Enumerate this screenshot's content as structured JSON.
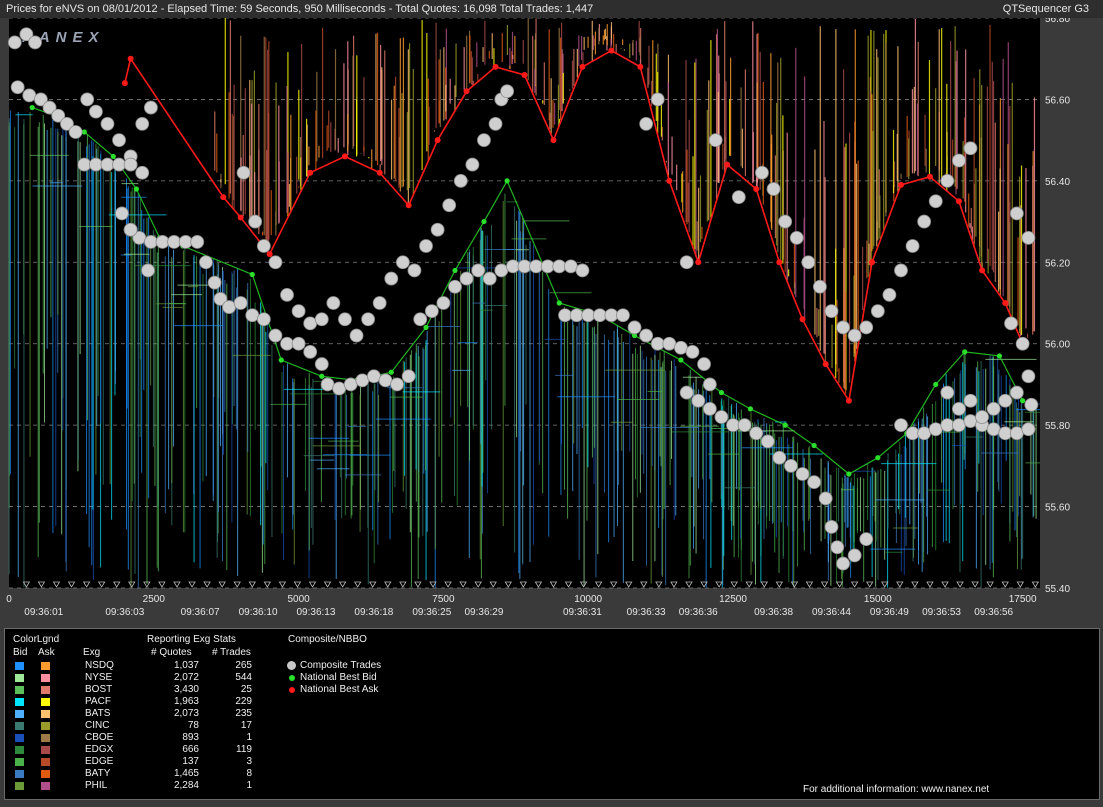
{
  "header": {
    "left": "Prices for  eNVS  on  08/01/2012  -  Elapsed Time: 59 Seconds, 950 Milliseconds  -  Total Quotes: 16,098  Total Trades: 1,447",
    "right": "QTSequencer G3"
  },
  "watermark": "NANEX",
  "chart_data": {
    "type": "scatter",
    "xlim": [
      0,
      17800
    ],
    "ylim": [
      55.4,
      56.8
    ],
    "x_ticks": [
      0,
      2500,
      5000,
      7500,
      10000,
      12500,
      15000,
      17500
    ],
    "y_ticks": [
      "56.80",
      "56.60",
      "56.40",
      "56.20",
      "56.00",
      "55.80",
      "55.60",
      "55.40"
    ],
    "time_ticks": [
      {
        "x": 600,
        "label": "09:36:01"
      },
      {
        "x": 2000,
        "label": "09:36:03"
      },
      {
        "x": 3300,
        "label": "09:36:07"
      },
      {
        "x": 4300,
        "label": "09:36:10"
      },
      {
        "x": 5300,
        "label": "09:36:13"
      },
      {
        "x": 6300,
        "label": "09:36:18"
      },
      {
        "x": 7300,
        "label": "09:36:25"
      },
      {
        "x": 8200,
        "label": "09:36:29"
      },
      {
        "x": 9900,
        "label": "09:36:31"
      },
      {
        "x": 11000,
        "label": "09:36:33"
      },
      {
        "x": 11900,
        "label": "09:36:36"
      },
      {
        "x": 13200,
        "label": "09:36:38"
      },
      {
        "x": 14200,
        "label": "09:36:44"
      },
      {
        "x": 15200,
        "label": "09:36:49"
      },
      {
        "x": 16100,
        "label": "09:36:53"
      },
      {
        "x": 17000,
        "label": "09:36:56"
      }
    ],
    "grid": true,
    "composite_trades": [
      [
        100,
        56.74
      ],
      [
        300,
        56.76
      ],
      [
        450,
        56.74
      ],
      [
        150,
        56.63
      ],
      [
        350,
        56.61
      ],
      [
        550,
        56.6
      ],
      [
        700,
        56.58
      ],
      [
        850,
        56.56
      ],
      [
        1000,
        56.54
      ],
      [
        1150,
        56.52
      ],
      [
        1350,
        56.6
      ],
      [
        1500,
        56.57
      ],
      [
        1700,
        56.54
      ],
      [
        1900,
        56.5
      ],
      [
        2100,
        56.46
      ],
      [
        2300,
        56.54
      ],
      [
        2450,
        56.58
      ],
      [
        1300,
        56.44
      ],
      [
        1500,
        56.44
      ],
      [
        1700,
        56.44
      ],
      [
        1900,
        56.44
      ],
      [
        2100,
        56.44
      ],
      [
        2300,
        56.42
      ],
      [
        1950,
        56.32
      ],
      [
        2100,
        56.28
      ],
      [
        2250,
        56.26
      ],
      [
        2450,
        56.25
      ],
      [
        2650,
        56.25
      ],
      [
        2850,
        56.25
      ],
      [
        3050,
        56.25
      ],
      [
        3250,
        56.25
      ],
      [
        3400,
        56.2
      ],
      [
        3550,
        56.15
      ],
      [
        3650,
        56.11
      ],
      [
        3800,
        56.09
      ],
      [
        4000,
        56.1
      ],
      [
        4200,
        56.07
      ],
      [
        4400,
        56.06
      ],
      [
        4600,
        56.02
      ],
      [
        4800,
        56.0
      ],
      [
        5000,
        56.0
      ],
      [
        5200,
        55.98
      ],
      [
        5400,
        55.95
      ],
      [
        5500,
        55.9
      ],
      [
        5700,
        55.89
      ],
      [
        5900,
        55.9
      ],
      [
        6100,
        55.91
      ],
      [
        6300,
        55.92
      ],
      [
        6500,
        55.91
      ],
      [
        6700,
        55.9
      ],
      [
        6900,
        55.92
      ],
      [
        4050,
        56.42
      ],
      [
        4250,
        56.3
      ],
      [
        4400,
        56.24
      ],
      [
        4600,
        56.2
      ],
      [
        4800,
        56.12
      ],
      [
        5000,
        56.08
      ],
      [
        5200,
        56.05
      ],
      [
        5400,
        56.06
      ],
      [
        5600,
        56.1
      ],
      [
        5800,
        56.06
      ],
      [
        6000,
        56.02
      ],
      [
        6200,
        56.06
      ],
      [
        6400,
        56.1
      ],
      [
        6600,
        56.16
      ],
      [
        6800,
        56.2
      ],
      [
        7000,
        56.18
      ],
      [
        7200,
        56.24
      ],
      [
        7400,
        56.28
      ],
      [
        7600,
        56.34
      ],
      [
        7800,
        56.4
      ],
      [
        8000,
        56.44
      ],
      [
        8200,
        56.5
      ],
      [
        8400,
        56.54
      ],
      [
        8500,
        56.6
      ],
      [
        8600,
        56.62
      ],
      [
        7100,
        56.06
      ],
      [
        7300,
        56.08
      ],
      [
        7500,
        56.1
      ],
      [
        7700,
        56.14
      ],
      [
        7900,
        56.16
      ],
      [
        8100,
        56.18
      ],
      [
        8300,
        56.16
      ],
      [
        8500,
        56.18
      ],
      [
        8700,
        56.19
      ],
      [
        8900,
        56.19
      ],
      [
        9100,
        56.19
      ],
      [
        9300,
        56.19
      ],
      [
        9500,
        56.19
      ],
      [
        9700,
        56.19
      ],
      [
        9900,
        56.18
      ],
      [
        9600,
        56.07
      ],
      [
        9800,
        56.07
      ],
      [
        10000,
        56.07
      ],
      [
        10200,
        56.07
      ],
      [
        10400,
        56.07
      ],
      [
        10600,
        56.07
      ],
      [
        10800,
        56.04
      ],
      [
        11000,
        56.02
      ],
      [
        11200,
        56.0
      ],
      [
        11400,
        56.0
      ],
      [
        11600,
        55.99
      ],
      [
        11800,
        55.98
      ],
      [
        12000,
        55.95
      ],
      [
        12100,
        55.9
      ],
      [
        11700,
        55.88
      ],
      [
        11900,
        55.86
      ],
      [
        12100,
        55.84
      ],
      [
        12300,
        55.82
      ],
      [
        12500,
        55.8
      ],
      [
        12700,
        55.8
      ],
      [
        12900,
        55.78
      ],
      [
        13100,
        55.76
      ],
      [
        13300,
        55.72
      ],
      [
        13500,
        55.7
      ],
      [
        13700,
        55.68
      ],
      [
        13900,
        55.66
      ],
      [
        14100,
        55.62
      ],
      [
        14200,
        55.55
      ],
      [
        14300,
        55.5
      ],
      [
        14400,
        55.46
      ],
      [
        14600,
        55.48
      ],
      [
        14800,
        55.52
      ],
      [
        13000,
        56.42
      ],
      [
        13200,
        56.38
      ],
      [
        13400,
        56.3
      ],
      [
        13600,
        56.26
      ],
      [
        13800,
        56.2
      ],
      [
        14000,
        56.14
      ],
      [
        14200,
        56.08
      ],
      [
        14400,
        56.04
      ],
      [
        14600,
        56.02
      ],
      [
        14800,
        56.04
      ],
      [
        15000,
        56.08
      ],
      [
        15200,
        56.12
      ],
      [
        15400,
        56.18
      ],
      [
        15600,
        56.24
      ],
      [
        15800,
        56.3
      ],
      [
        16000,
        56.35
      ],
      [
        16200,
        56.4
      ],
      [
        16400,
        56.45
      ],
      [
        16600,
        56.48
      ],
      [
        15400,
        55.8
      ],
      [
        15600,
        55.78
      ],
      [
        15800,
        55.78
      ],
      [
        16000,
        55.79
      ],
      [
        16200,
        55.8
      ],
      [
        16400,
        55.8
      ],
      [
        16600,
        55.81
      ],
      [
        16800,
        55.8
      ],
      [
        17000,
        55.79
      ],
      [
        17200,
        55.78
      ],
      [
        17400,
        55.78
      ],
      [
        17600,
        55.79
      ],
      [
        16200,
        55.88
      ],
      [
        16400,
        55.84
      ],
      [
        16600,
        55.86
      ],
      [
        16800,
        55.82
      ],
      [
        17000,
        55.84
      ],
      [
        17200,
        55.86
      ],
      [
        17400,
        55.88
      ],
      [
        17600,
        55.92
      ],
      [
        11000,
        56.54
      ],
      [
        11200,
        56.6
      ],
      [
        12200,
        56.5
      ],
      [
        12600,
        56.36
      ],
      [
        11700,
        56.2
      ],
      [
        17400,
        56.32
      ],
      [
        17600,
        56.26
      ],
      [
        17300,
        56.05
      ],
      [
        17500,
        56.0
      ],
      [
        17650,
        55.85
      ],
      [
        2400,
        56.18
      ],
      [
        2100,
        56.28
      ]
    ],
    "national_best_bid": [
      [
        400,
        56.58
      ],
      [
        800,
        56.56
      ],
      [
        1300,
        56.52
      ],
      [
        1800,
        56.46
      ],
      [
        2200,
        56.38
      ],
      [
        2600,
        56.26
      ],
      [
        3000,
        56.24
      ],
      [
        4200,
        56.17
      ],
      [
        4700,
        55.96
      ],
      [
        5400,
        55.92
      ],
      [
        6000,
        55.91
      ],
      [
        6600,
        55.93
      ],
      [
        7200,
        56.04
      ],
      [
        7700,
        56.18
      ],
      [
        8200,
        56.3
      ],
      [
        8600,
        56.4
      ],
      [
        9500,
        56.1
      ],
      [
        10200,
        56.07
      ],
      [
        10800,
        56.02
      ],
      [
        11600,
        55.96
      ],
      [
        12300,
        55.88
      ],
      [
        12800,
        55.84
      ],
      [
        13400,
        55.8
      ],
      [
        13900,
        55.75
      ],
      [
        14500,
        55.68
      ],
      [
        15000,
        55.72
      ],
      [
        15500,
        55.78
      ],
      [
        16000,
        55.9
      ],
      [
        16500,
        55.98
      ],
      [
        17100,
        55.97
      ],
      [
        17500,
        55.86
      ]
    ],
    "national_best_ask": [
      [
        2000,
        56.64
      ],
      [
        2100,
        56.7
      ],
      [
        3700,
        56.36
      ],
      [
        4000,
        56.31
      ],
      [
        4500,
        56.22
      ],
      [
        5200,
        56.42
      ],
      [
        5800,
        56.46
      ],
      [
        6400,
        56.42
      ],
      [
        6900,
        56.34
      ],
      [
        7400,
        56.5
      ],
      [
        7900,
        56.62
      ],
      [
        8400,
        56.68
      ],
      [
        8900,
        56.66
      ],
      [
        9400,
        56.5
      ],
      [
        9900,
        56.68
      ],
      [
        10400,
        56.72
      ],
      [
        10900,
        56.68
      ],
      [
        11400,
        56.4
      ],
      [
        11900,
        56.2
      ],
      [
        12400,
        56.44
      ],
      [
        12900,
        56.38
      ],
      [
        13300,
        56.2
      ],
      [
        13700,
        56.06
      ],
      [
        14100,
        55.95
      ],
      [
        14500,
        55.86
      ],
      [
        14900,
        56.2
      ],
      [
        15400,
        56.39
      ],
      [
        15900,
        56.41
      ],
      [
        16400,
        56.35
      ],
      [
        16800,
        56.18
      ],
      [
        17200,
        56.1
      ],
      [
        17500,
        56.0
      ]
    ],
    "legend": {
      "header": "ColorLgnd",
      "bid_label": "Bid",
      "ask_label": "Ask",
      "col_exg": "Exg",
      "stats_title": "Reporting Exg Stats",
      "col_quotes": "# Quotes",
      "col_trades": "# Trades",
      "nbbo_title": "Composite/NBBO",
      "exchanges": [
        {
          "name": "NSDQ",
          "quotes": "1,037",
          "trades": "265",
          "bid": "#1e90ff",
          "ask": "#ff9a2e"
        },
        {
          "name": "NYSE",
          "quotes": "2,072",
          "trades": "544",
          "bid": "#9fe89a",
          "ask": "#ff8fa0"
        },
        {
          "name": "BOST",
          "quotes": "3,430",
          "trades": "25",
          "bid": "#5cbf5c",
          "ask": "#e07a6a"
        },
        {
          "name": "PACF",
          "quotes": "1,963",
          "trades": "229",
          "bid": "#00e6ff",
          "ask": "#ffff00"
        },
        {
          "name": "BATS",
          "quotes": "2,073",
          "trades": "235",
          "bid": "#4fb0ff",
          "ask": "#ffc070"
        },
        {
          "name": "CINC",
          "quotes": "78",
          "trades": "17",
          "bid": "#3a7a70",
          "ask": "#9c9c2a"
        },
        {
          "name": "CBOE",
          "quotes": "893",
          "trades": "1",
          "bid": "#1a4fb8",
          "ask": "#9e7a48"
        },
        {
          "name": "EDGX",
          "quotes": "666",
          "trades": "119",
          "bid": "#2e8a3a",
          "ask": "#a84a4a"
        },
        {
          "name": "EDGE",
          "quotes": "137",
          "trades": "3",
          "bid": "#4ab04a",
          "ask": "#b84a2a"
        },
        {
          "name": "BATY",
          "quotes": "1,465",
          "trades": "8",
          "bid": "#3a7ac0",
          "ask": "#e05a10"
        },
        {
          "name": "PHIL",
          "quotes": "2,284",
          "trades": "1",
          "bid": "#6a9a3a",
          "ask": "#b0508a"
        }
      ],
      "nbbo_items": [
        {
          "label": "Composite Trades",
          "color": "#c8c8c8"
        },
        {
          "label": "National Best Bid",
          "color": "#2ae02a"
        },
        {
          "label": "National Best Ask",
          "color": "#ff1a1a"
        }
      ]
    }
  },
  "footer": "For additional information: www.nanex.net"
}
